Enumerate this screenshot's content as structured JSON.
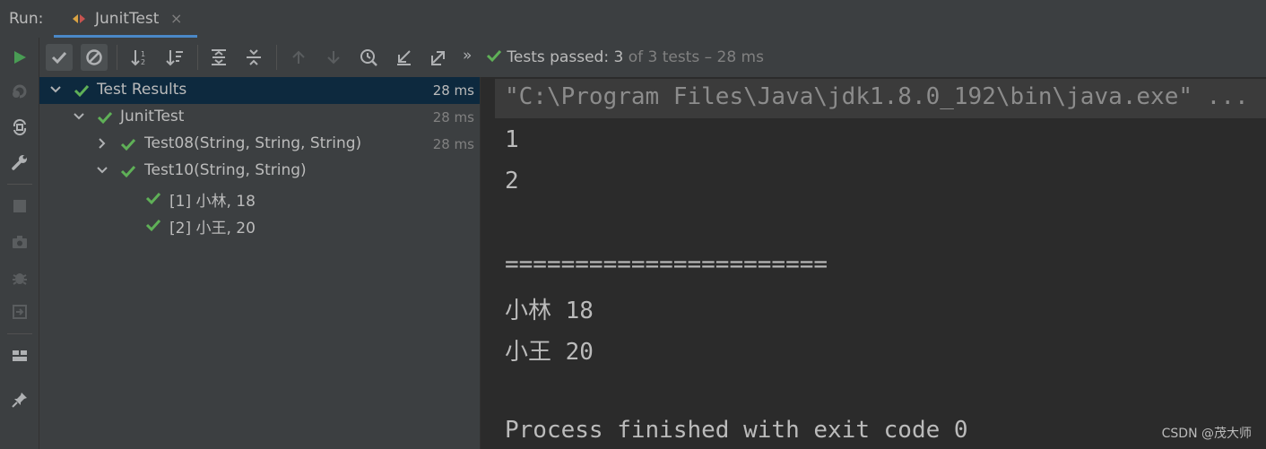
{
  "runbar": {
    "label": "Run:",
    "tab_label": "JunitTest",
    "tab_close": "×"
  },
  "status": {
    "prefix": "Tests passed:",
    "count": "3",
    "suffix": "of 3 tests – 28 ms"
  },
  "toolbar": {
    "more": "»"
  },
  "tree": [
    {
      "name": "Test Results",
      "time": "28 ms"
    },
    {
      "name": "JunitTest",
      "time": "28 ms"
    },
    {
      "name": "Test08(String, String, String)",
      "time": "28 ms"
    },
    {
      "name": "Test10(String, String)",
      "time": ""
    },
    {
      "name": "[1] 小林, 18",
      "time": ""
    },
    {
      "name": "[2] 小王, 20",
      "time": ""
    }
  ],
  "console": {
    "command": "\"C:\\Program Files\\Java\\jdk1.8.0_192\\bin\\java.exe\" ...",
    "lines": [
      "1",
      "2",
      "",
      "=======================",
      "小林 18",
      "小王 20",
      "",
      "Process finished with exit code 0"
    ]
  },
  "watermark": "CSDN @茂大师",
  "colors": {
    "pass_green": "#5fb057",
    "run_green": "#499c54",
    "selection": "#0d293e",
    "console_bg": "#2b2b2b"
  }
}
